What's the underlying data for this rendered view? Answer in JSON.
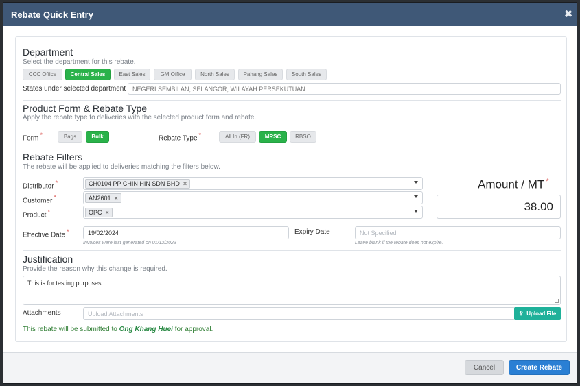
{
  "modal": {
    "title": "Rebate Quick Entry",
    "close_icon": "times-icon"
  },
  "department": {
    "title": "Department",
    "subtitle": "Select the department for this rebate.",
    "options": [
      "CCC Office",
      "Central Sales",
      "East Sales",
      "GM Office",
      "North Sales",
      "Pahang Sales",
      "South Sales"
    ],
    "selected": "Central Sales",
    "states_label": "States under selected department",
    "states_value": "NEGERI SEMBILAN, SELANGOR, WILAYAH PERSEKUTUAN"
  },
  "product": {
    "title": "Product Form & Rebate Type",
    "subtitle": "Apply the rebate type to deliveries with the selected product form and rebate.",
    "form_label": "Form",
    "form_options": [
      "Bags",
      "Bulk"
    ],
    "form_selected": "Bulk",
    "type_label": "Rebate Type",
    "type_options": [
      "All In (FR)",
      "MRSC",
      "RBSO"
    ],
    "type_selected": "MRSC"
  },
  "filters": {
    "title": "Rebate Filters",
    "subtitle": "The rebate will be applied to deliveries matching the filters below.",
    "distributor_label": "Distributor",
    "distributor_tag": "CH0104 PP CHIN HIN SDN BHD",
    "customer_label": "Customer",
    "customer_tag": "AN2601",
    "product_label": "Product",
    "product_tag": "OPC",
    "tag_remove": "×",
    "amount_label": "Amount / MT",
    "amount_value": "38.00",
    "effective_label": "Effective Date",
    "effective_value": "19/02/2024",
    "effective_hint": "Invoices were last generated on 01/12/2023",
    "expiry_label": "Expiry Date",
    "expiry_placeholder": "Not Specified",
    "expiry_hint": "Leave blank if the rebate does not expire."
  },
  "justification": {
    "title": "Justification",
    "subtitle": "Provide the reason why this change is required.",
    "value": "This is for testing purposes.",
    "attachments_label": "Attachments",
    "attachments_placeholder": "Upload Attachments",
    "upload_label": "Upload File"
  },
  "note": {
    "prefix": "This rebate will be submitted to",
    "approver": "Ong Khang Huei",
    "suffix": "for approval."
  },
  "footer": {
    "cancel": "Cancel",
    "create": "Create Rebate"
  }
}
